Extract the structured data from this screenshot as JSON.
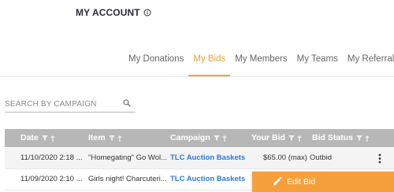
{
  "header": {
    "title": "MY ACCOUNT",
    "info_icon": "info-icon"
  },
  "tabs": [
    {
      "label": "My Donations",
      "active": false
    },
    {
      "label": "My Bids",
      "active": true
    },
    {
      "label": "My Members",
      "active": false
    },
    {
      "label": "My Teams",
      "active": false
    },
    {
      "label": "My Referrals",
      "active": false
    }
  ],
  "search": {
    "placeholder": "SEARCH BY CAMPAIGN",
    "value": "",
    "icon": "search-icon"
  },
  "table": {
    "columns": [
      {
        "label": "Date"
      },
      {
        "label": "Item"
      },
      {
        "label": "Campaign"
      },
      {
        "label": "Your Bid"
      },
      {
        "label": "Bid Status"
      }
    ],
    "rows": [
      {
        "date": "11/10/2020 2:18 ...",
        "item": "\"Homegating\" Go Wol...",
        "campaign": "TLC Auction Baskets",
        "bid": "$65.00 (max)",
        "status": "Outbid"
      },
      {
        "date": "11/09/2020 2:10 ...",
        "item": "Girls night! Charcuteri...",
        "campaign": "TLC Auction Baskets",
        "bid": "",
        "status": ""
      }
    ]
  },
  "row_menu": {
    "items": [
      {
        "label": "Edit Bid",
        "icon": "pencil-icon"
      }
    ]
  },
  "colors": {
    "accent": "#f2a13b",
    "link": "#2a7ad8",
    "header_bg": "#b7b7b7",
    "menu_bg": "#f6a03c"
  }
}
